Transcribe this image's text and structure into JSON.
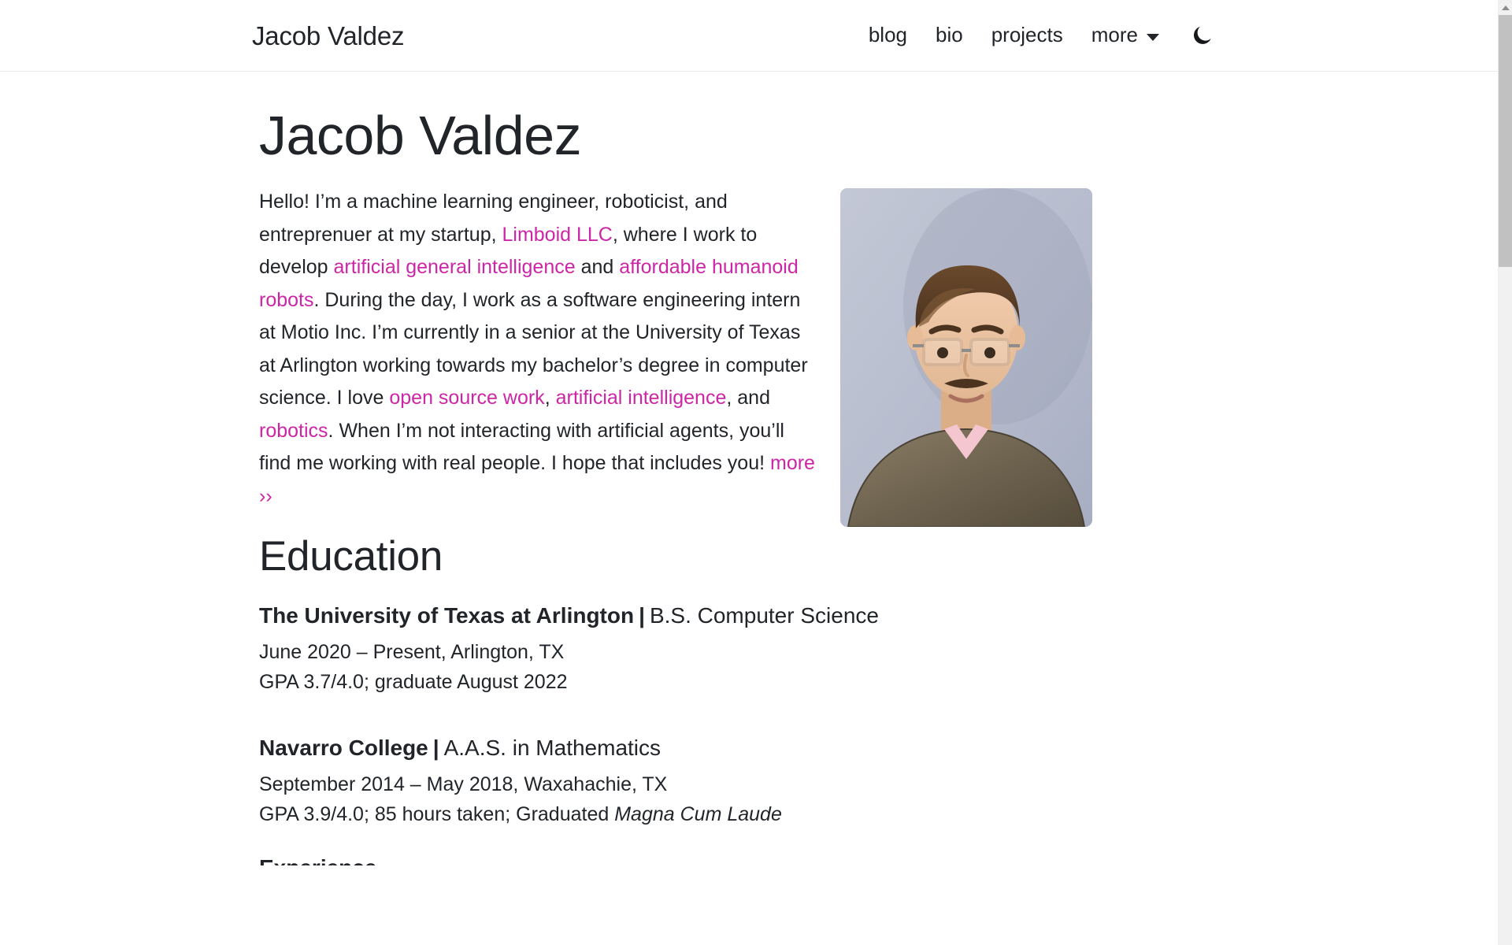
{
  "header": {
    "brand": "Jacob Valdez",
    "nav_items": [
      {
        "label": "blog"
      },
      {
        "label": "bio"
      },
      {
        "label": "projects"
      }
    ],
    "dropdown_label": "more",
    "caret_icon": "chevron-down-icon",
    "theme_toggle_icon": "moon-icon"
  },
  "main": {
    "title": "Jacob Valdez",
    "intro": {
      "p1": "Hello! I’m a machine learning engineer, roboticist, and entreprenuer at my startup, ",
      "link_limboid": "Limboid LLC",
      "p2": ", where I work to develop ",
      "link_agi": "artificial general intelligence",
      "p3": " and ",
      "link_robots": "affordable humanoid robots",
      "p4": ". During the day, I work as a software engineering intern at Motio Inc. I’m currently in a senior at the University of Texas at Arlington working towards my bachelor’s degree in computer science. I love ",
      "link_open_source": "open source work",
      "p5": ", ",
      "link_ai": "artificial intelligence",
      "p6": ", and ",
      "link_robotics": "robotics",
      "p7": ". When I’m not interacting with artificial agents, you’ll find me working with real people. I hope that includes you! ",
      "link_more": "more ››"
    },
    "photo_alt": "Jacob Valdez portrait photo",
    "education": {
      "heading": "Education",
      "entries": [
        {
          "school": "The University of Texas at Arlington",
          "separator": "|",
          "degree": "B.S. Computer Science",
          "dates_location": "June 2020 – Present, Arlington, TX",
          "details": "GPA 3.7/4.0; graduate August 2022",
          "honors": ""
        },
        {
          "school": "Navarro College",
          "separator": "|",
          "degree": "A.A.S. in Mathematics",
          "dates_location": "September 2014 – May 2018, Waxahachie, TX",
          "details": "GPA 3.9/4.0; 85 hours taken; Graduated ",
          "honors": "Magna Cum Laude"
        }
      ]
    },
    "next_section_partial": "Experience"
  },
  "scrollbar": {
    "up_arrow_icon": "scroll-up-arrow-icon"
  },
  "colors": {
    "link": "#cc26a7",
    "text": "#212529",
    "header_border": "#e9ecef",
    "scrollbar_track": "#f1f1f1",
    "scrollbar_thumb": "#c1c1c1"
  }
}
